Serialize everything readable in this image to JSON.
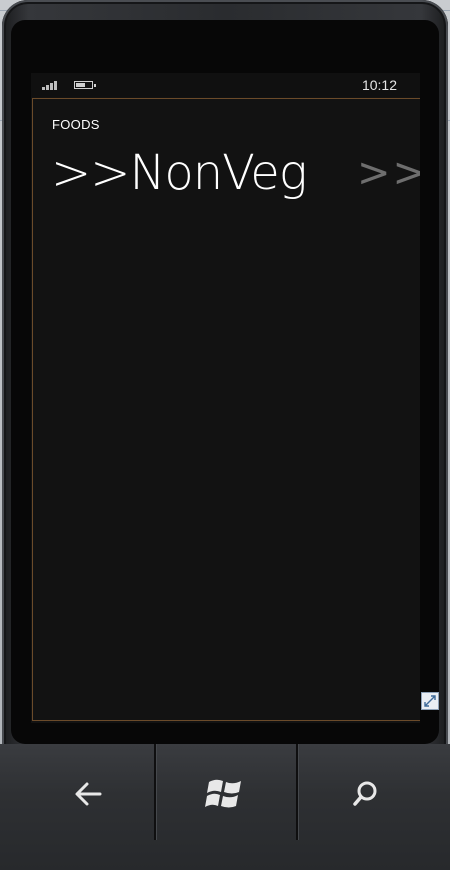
{
  "status_bar": {
    "time": "10:12",
    "signal_bars": 4,
    "battery_level": 0.6
  },
  "app": {
    "title": "FOODS"
  },
  "pivot": {
    "active_header": ">>NonVeg",
    "next_header": ">>"
  },
  "hardware_buttons": [
    {
      "icon": "back-arrow-icon"
    },
    {
      "icon": "windows-logo-icon"
    },
    {
      "icon": "search-icon"
    }
  ],
  "colors": {
    "screen_background": "#121212",
    "text_primary": "#ffffff",
    "text_dim": "#6e6e6e",
    "page_border": "#6b4b2a"
  }
}
